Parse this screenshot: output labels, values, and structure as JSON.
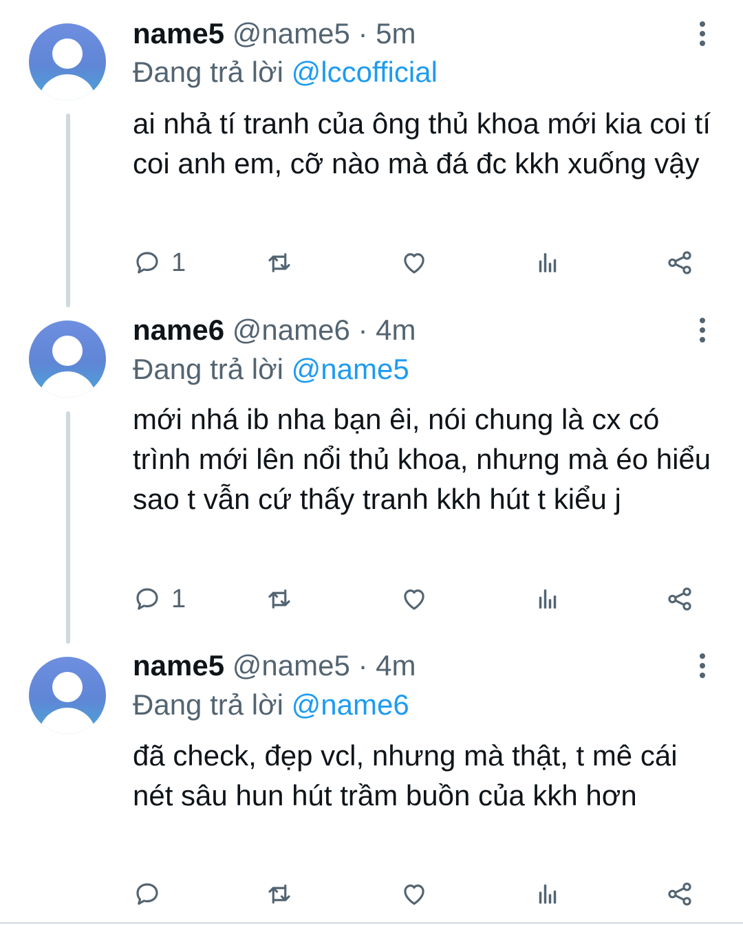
{
  "tweets": [
    {
      "display_name": "name5",
      "handle": "@name5",
      "separator": "·",
      "time": "5m",
      "reply_prefix": "Đang trả lời ",
      "reply_to": "@lccofficial",
      "text": "ai nhả tí tranh của ông thủ khoa mới kia coi tí coi anh em, cỡ nào mà đá đc kkh xuống vậy",
      "reply_count": "1"
    },
    {
      "display_name": "name6",
      "handle": "@name6",
      "separator": "·",
      "time": "4m",
      "reply_prefix": "Đang trả lời ",
      "reply_to": "@name5",
      "text": "mới nhá ib nha bạn êi, nói chung là cx có trình mới lên nổi thủ khoa, nhưng mà éo hiểu sao t vẫn cứ thấy tranh kkh hút t kiểu j",
      "reply_count": "1"
    },
    {
      "display_name": "name5",
      "handle": "@name5",
      "separator": "·",
      "time": "4m",
      "reply_prefix": "Đang trả lời ",
      "reply_to": "@name6",
      "text": "đã check, đẹp vcl, nhưng mà thật, t mê cái nét sâu hun hút trầm buồn của kkh hơn",
      "reply_count": ""
    }
  ],
  "icons": {
    "avatar": "default-avatar-icon",
    "more": "more-vertical-icon",
    "reply": "reply-bubble-icon",
    "retweet": "retweet-icon",
    "like": "heart-icon",
    "views": "views-bar-chart-icon",
    "share": "share-icon"
  },
  "colors": {
    "mention": "#1d9bf0",
    "secondary_text": "#536471",
    "primary_text": "#0f1419",
    "thread_line": "#cfd9de"
  }
}
